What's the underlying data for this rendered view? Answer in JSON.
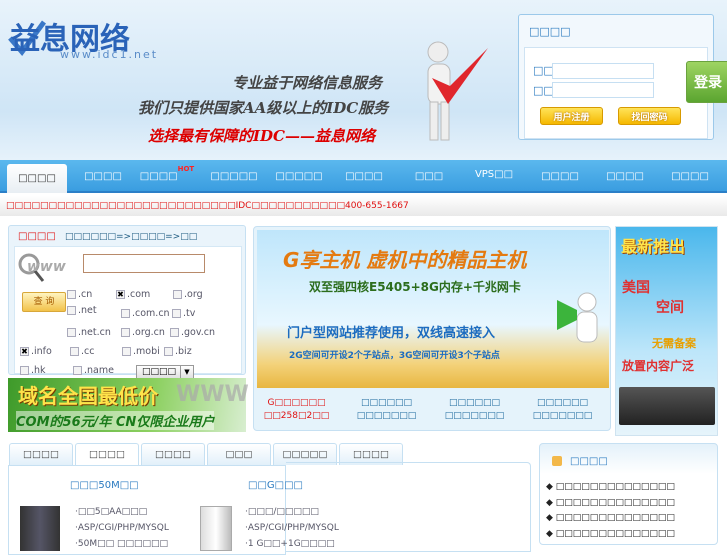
{
  "header": {
    "logo_text": "益息网络",
    "logo_url": "www.idc1.net",
    "slogans": [
      "专业益于网络信息服务",
      "我们只提供国家AA级以上的IDC服务",
      "选择最有保障的IDC——益息网络"
    ]
  },
  "login": {
    "title": "□□□□",
    "username_label": "□□",
    "password_label": "□□",
    "username_value": "",
    "password_value": "",
    "login_button": "登录",
    "register_button": "用户注册",
    "recover_button": "找回密码"
  },
  "nav": {
    "items": [
      {
        "label": "□□□□"
      },
      {
        "label": "□□□□"
      },
      {
        "label": "□□□□",
        "badge": "HOT"
      },
      {
        "label": "□□□□□"
      },
      {
        "label": "□□□□□"
      },
      {
        "label": "□□□□"
      },
      {
        "label": "□□□"
      },
      {
        "label": "VPS□□"
      },
      {
        "label": "□□□□"
      },
      {
        "label": "□□□□"
      },
      {
        "label": "□□□□"
      }
    ]
  },
  "notice": {
    "text": "□□□□□□□□□□□□□□□□□□□□□□□□□□□IDC□□□□□□□□□□□400-655-1667"
  },
  "domain": {
    "title": "□□□□",
    "steps": "□□□□□□=>□□□□=>□□",
    "search_value": "",
    "search_button": "查 询",
    "select_value": "□□□□",
    "tlds": [
      {
        "label": ".cn",
        "checked": false
      },
      {
        "label": ".com",
        "checked": true
      },
      {
        "label": ".org",
        "checked": false
      },
      {
        "label": ".net",
        "checked": false
      },
      {
        "label": ".com.cn",
        "checked": false
      },
      {
        "label": ".tv",
        "checked": false
      },
      {
        "label": ".net.cn",
        "checked": false
      },
      {
        "label": ".org.cn",
        "checked": false
      },
      {
        "label": ".gov.cn",
        "checked": false
      },
      {
        "label": ".info",
        "checked": true
      },
      {
        "label": ".cc",
        "checked": false
      },
      {
        "label": ".mobi",
        "checked": false
      },
      {
        "label": ".biz",
        "checked": false
      },
      {
        "label": ".hk",
        "checked": false
      },
      {
        "label": ".name",
        "checked": false
      }
    ],
    "promo_title": "域名全国最低价",
    "promo_sub": "COM的56元/年  CN仅限企业用户"
  },
  "banner": {
    "title": "G享主机  虚机中的精品主机",
    "line1": "双至强四核E5405+8G内存+千兆网卡",
    "line2": "门户型网站推荐使用，双线高速接入",
    "line3": "2G空间可开设2个子站点，3G空间可开设3个子站点",
    "links": [
      {
        "l1": "G□□□□□□",
        "l2": "□□258□2□□",
        "hot": true
      },
      {
        "l1": "□□□□□□",
        "l2": "□□□□□□□"
      },
      {
        "l1": "□□□□□□",
        "l2": "□□□□□□□"
      },
      {
        "l1": "□□□□□□",
        "l2": "□□□□□□□"
      }
    ]
  },
  "side_ad": {
    "l1": "最新推出",
    "l2": "美国",
    "l3": "空间",
    "l4": "无需备案",
    "l5": "放置内容广泛"
  },
  "tabs": [
    {
      "label": "□□□□"
    },
    {
      "label": "□□□□"
    },
    {
      "label": "□□□□"
    },
    {
      "label": "□□□"
    },
    {
      "label": "□□□□□"
    },
    {
      "label": "□□□□"
    }
  ],
  "products": [
    {
      "title": "□□□50M□□",
      "features": [
        "·□□5□AA□□□",
        "·ASP/CGI/PHP/MYSQL",
        "·50M□□ □□□□□□"
      ]
    },
    {
      "title": "□□G□□□",
      "features": [
        "·□□□/□□□□□",
        "·ASP/CGI/PHP/MYSQL",
        "·1 G□□+1G□□□□"
      ]
    }
  ],
  "news": {
    "title": "□□□□",
    "items": [
      "□□□□□□□□□□□□□□",
      "□□□□□□□□□□□□□□",
      "□□□□□□□□□□□□□□",
      "□□□□□□□□□□□□□□"
    ]
  }
}
